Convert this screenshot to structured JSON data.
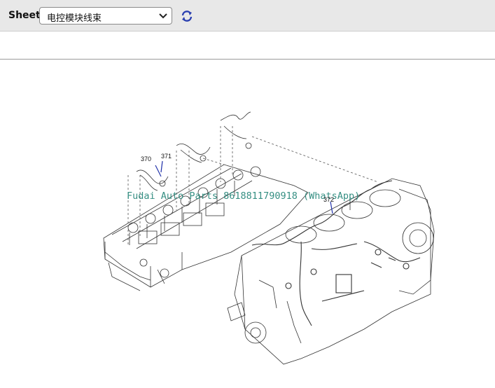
{
  "toolbar": {
    "sheet_label": "Sheet",
    "sheet_selected": "电控模块线束",
    "refresh_icon": "refresh-icon",
    "chevron_icon": "chevron-down-icon"
  },
  "diagram": {
    "watermark": "Fudai Auto Parts 8618811790918 (WhatsApp)",
    "callouts": [
      "370",
      "371",
      "372"
    ]
  },
  "colors": {
    "toolbar_bg": "#e8e8e8",
    "watermark": "#2c8a7d",
    "refresh": "#2a3fb0",
    "callout_line": "#2233aa"
  }
}
